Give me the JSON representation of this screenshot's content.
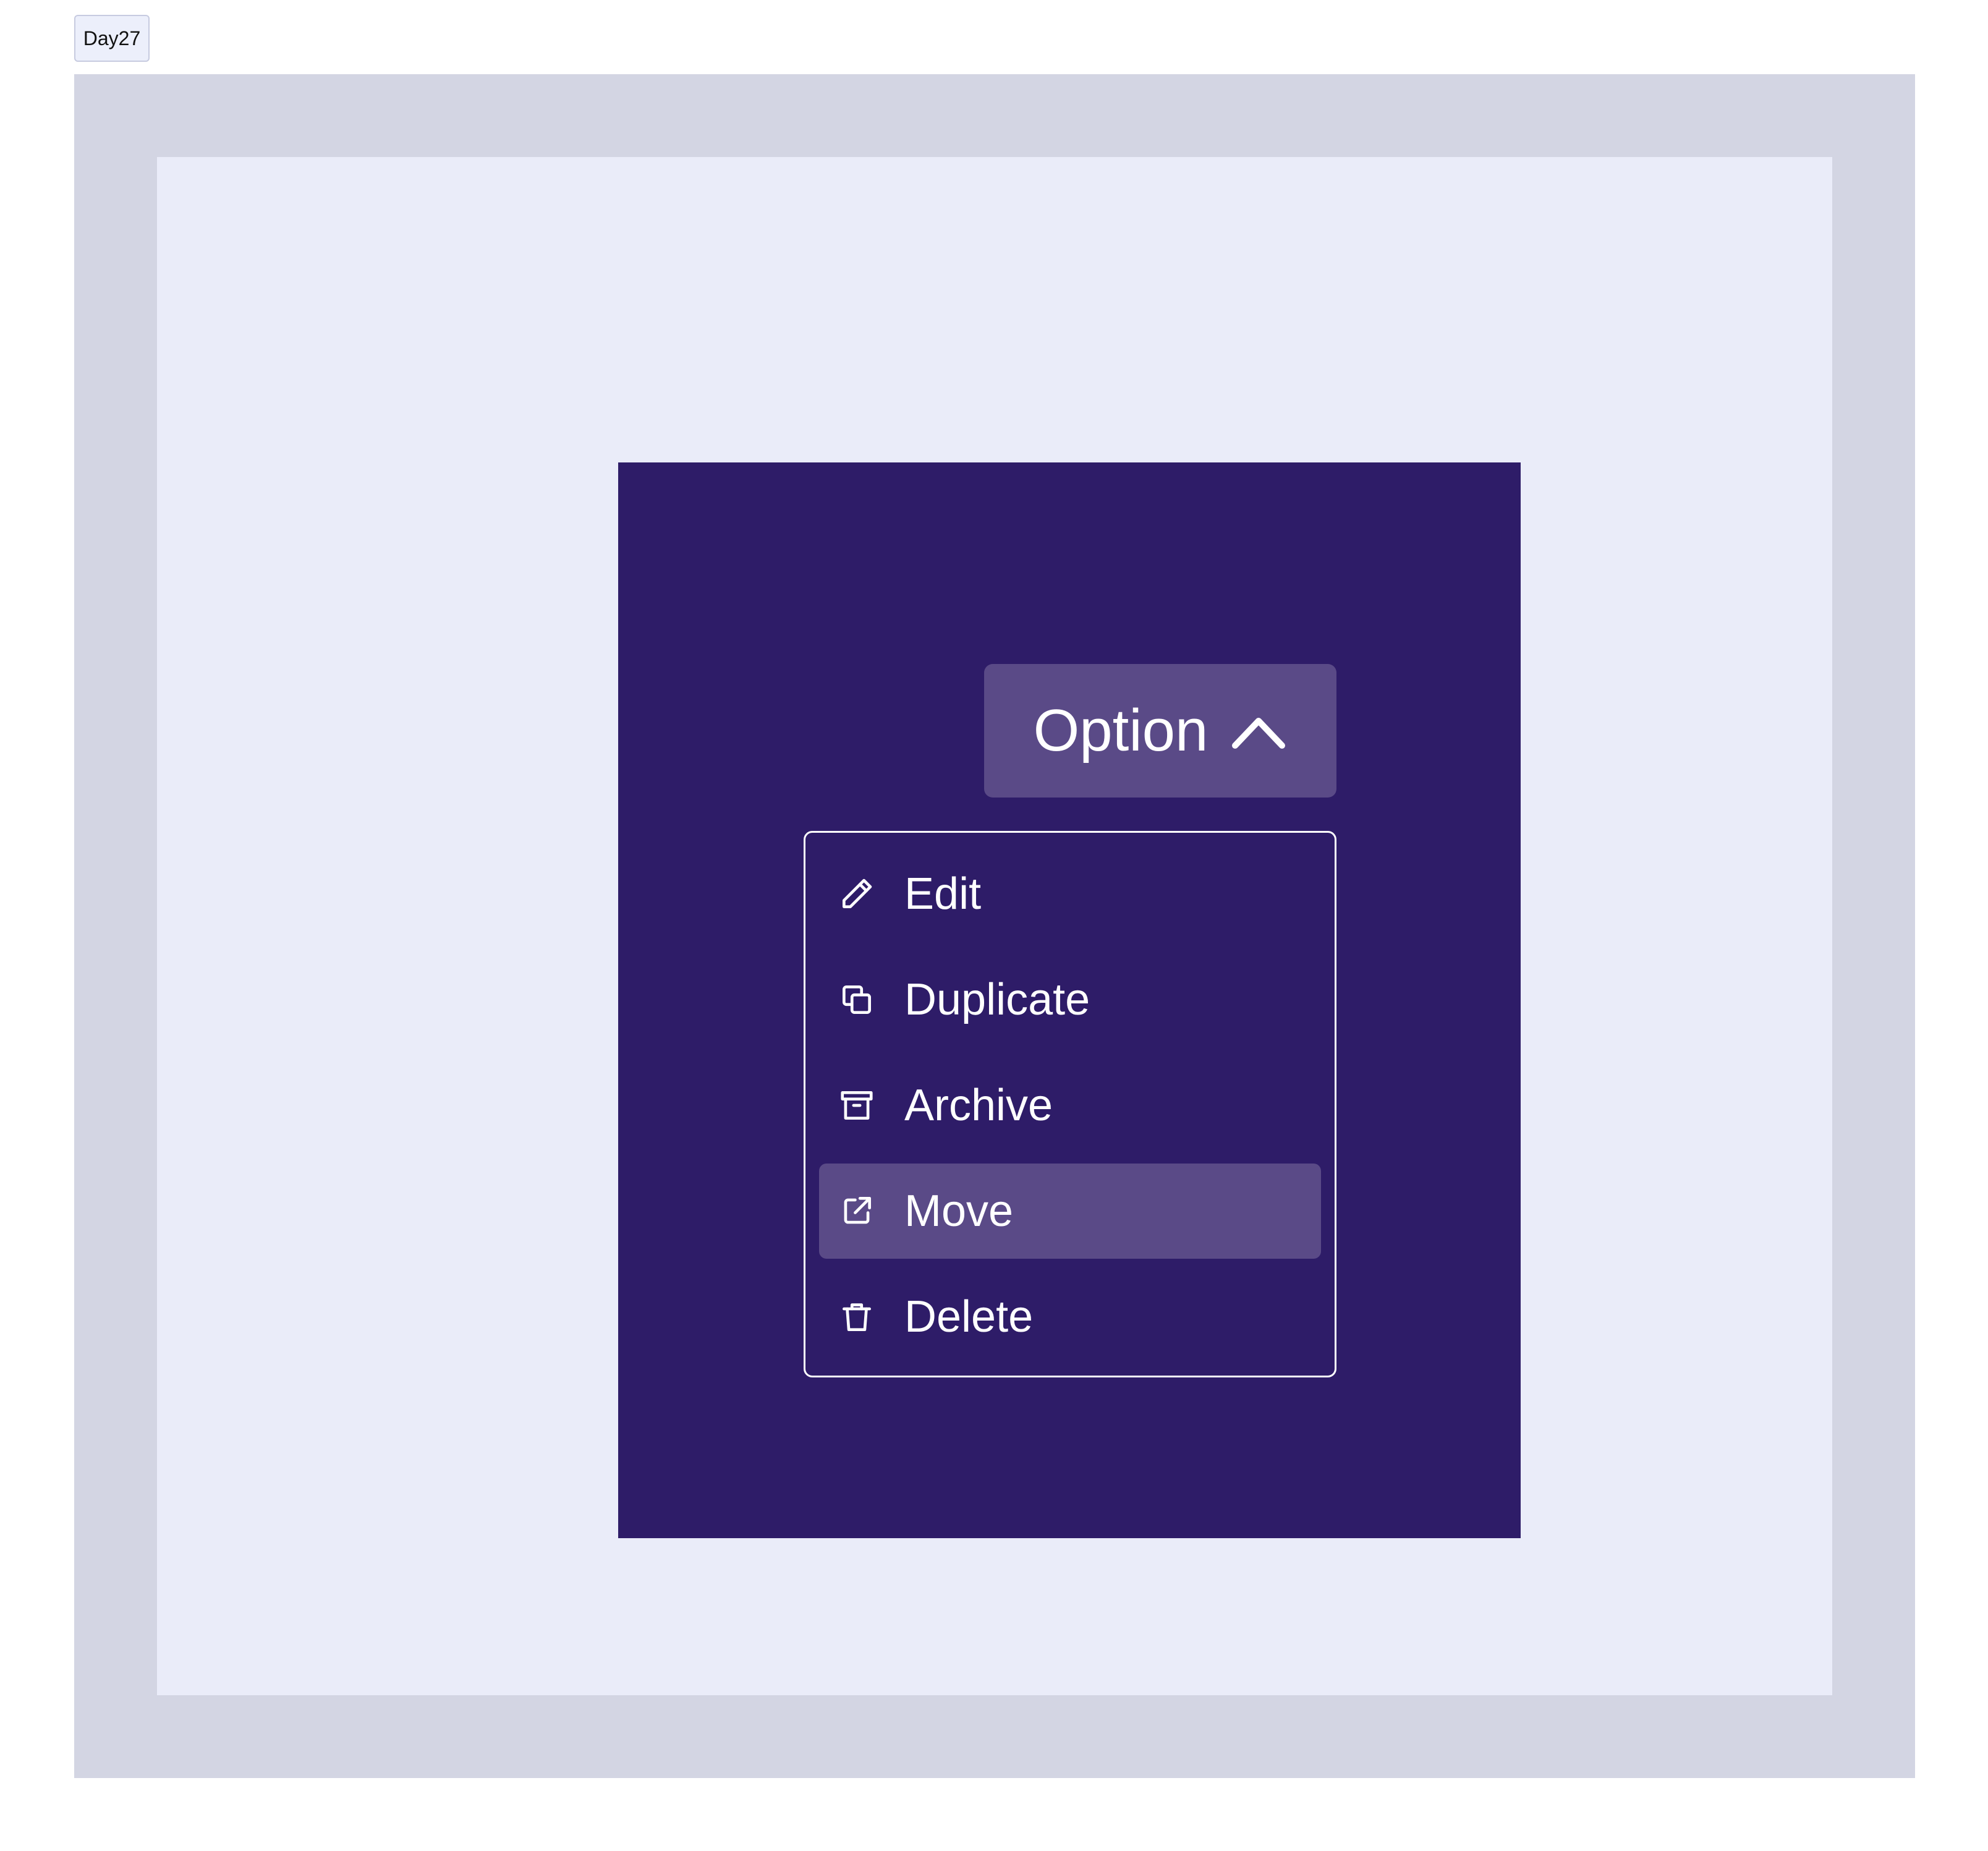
{
  "tag": {
    "label": "Day27"
  },
  "colors": {
    "outer_frame": "#d3d5e3",
    "inner_frame": "#eaecf9",
    "card": "#2e1c68",
    "button_bg": "#5a4a87",
    "active_item_bg": "#5a4a87",
    "text": "#ffffff"
  },
  "dropdown": {
    "button_label": "Option",
    "button_icon": "chevron-up-icon",
    "items": [
      {
        "label": "Edit",
        "icon": "pencil-icon",
        "active": false
      },
      {
        "label": "Duplicate",
        "icon": "duplicate-icon",
        "active": false
      },
      {
        "label": "Archive",
        "icon": "archive-icon",
        "active": false
      },
      {
        "label": "Move",
        "icon": "external-link-icon",
        "active": true
      },
      {
        "label": "Delete",
        "icon": "trash-icon",
        "active": false
      }
    ]
  }
}
